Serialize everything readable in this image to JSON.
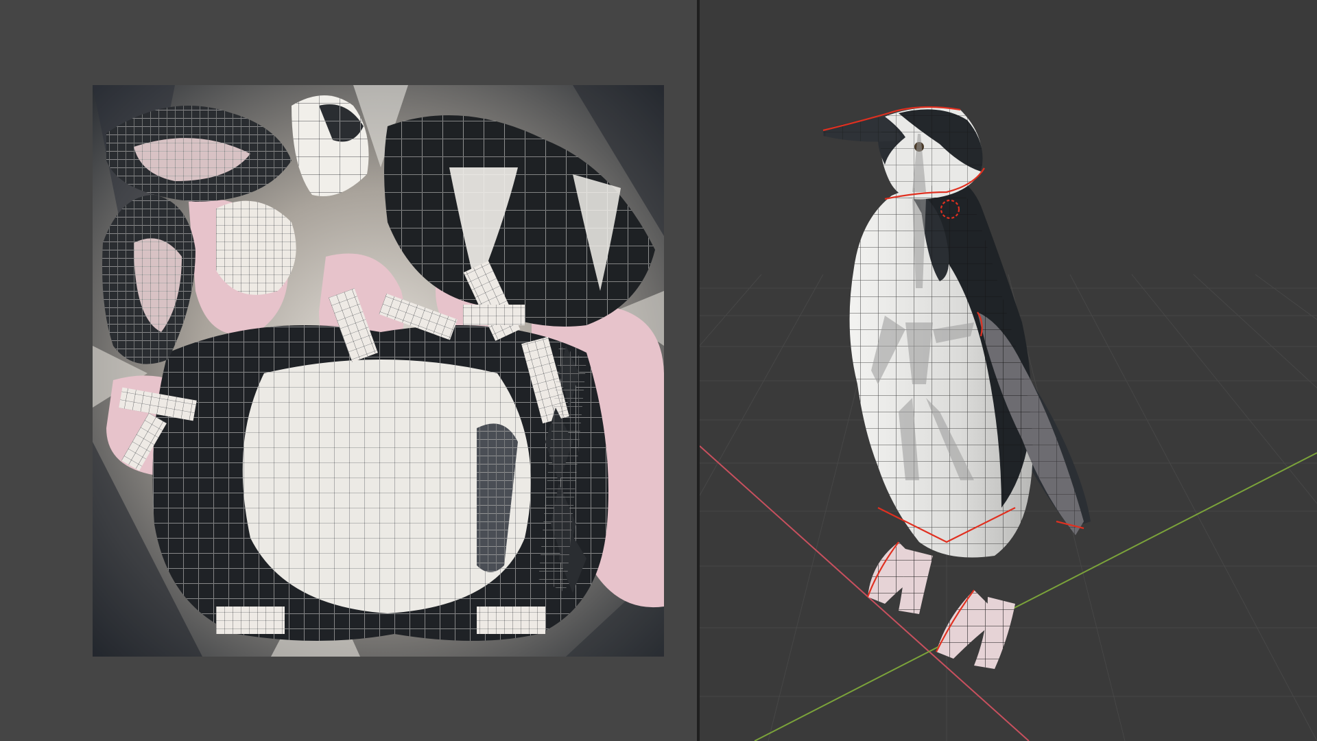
{
  "uv_editor": {
    "texture_description": "",
    "background_color": "#454545"
  },
  "viewport_3d": {
    "background_color": "#3a3a3a",
    "grid_color": "#4a4a4a",
    "x_axis_color": "#c8505e",
    "y_axis_color": "#7ba33a",
    "selection_outline_color": "#e03020"
  },
  "colors": {
    "penguin_dark": "#1e2124",
    "penguin_white": "#e8e8e6",
    "texture_pink": "#e6c4cc",
    "wire": "#111111",
    "uv_wire": "#ffffff"
  }
}
